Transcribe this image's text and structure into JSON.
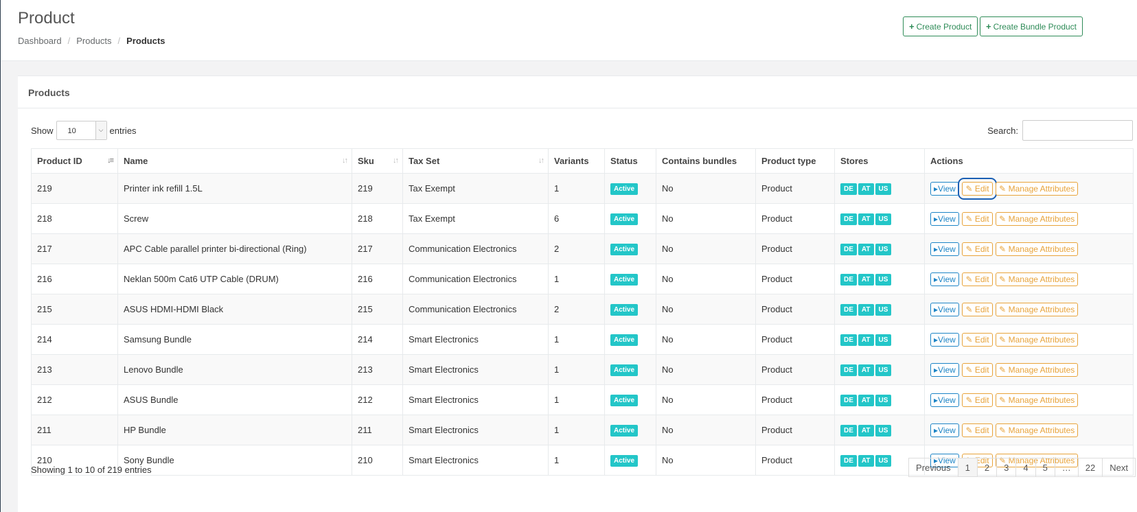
{
  "header": {
    "title": "Product",
    "breadcrumb": [
      "Dashboard",
      "Products",
      "Products"
    ],
    "create_product": "Create Product",
    "create_bundle": "Create Bundle Product"
  },
  "panel": {
    "title": "Products"
  },
  "length": {
    "show": "Show",
    "value": "10",
    "entries": "entries"
  },
  "search": {
    "label": "Search:"
  },
  "table": {
    "columns": [
      "Product ID",
      "Name",
      "Sku",
      "Tax Set",
      "Variants",
      "Status",
      "Contains bundles",
      "Product type",
      "Stores",
      "Actions"
    ],
    "action_labels": {
      "view": "View",
      "edit": "Edit",
      "attributes": "Manage Attributes"
    },
    "rows": [
      {
        "id": "219",
        "name": "Printer ink refill 1.5L",
        "sku": "219",
        "tax": "Tax Exempt",
        "variants": "1",
        "status": "Active",
        "bundles": "No",
        "type": "Product",
        "stores": [
          "DE",
          "AT",
          "US"
        ]
      },
      {
        "id": "218",
        "name": "Screw",
        "sku": "218",
        "tax": "Tax Exempt",
        "variants": "6",
        "status": "Active",
        "bundles": "No",
        "type": "Product",
        "stores": [
          "DE",
          "AT",
          "US"
        ]
      },
      {
        "id": "217",
        "name": "APC Cable parallel printer bi-directional (Ring)",
        "sku": "217",
        "tax": "Communication Electronics",
        "variants": "2",
        "status": "Active",
        "bundles": "No",
        "type": "Product",
        "stores": [
          "DE",
          "AT",
          "US"
        ]
      },
      {
        "id": "216",
        "name": "Neklan 500m Cat6 UTP Cable (DRUM)",
        "sku": "216",
        "tax": "Communication Electronics",
        "variants": "1",
        "status": "Active",
        "bundles": "No",
        "type": "Product",
        "stores": [
          "DE",
          "AT",
          "US"
        ]
      },
      {
        "id": "215",
        "name": "ASUS HDMI-HDMI Black",
        "sku": "215",
        "tax": "Communication Electronics",
        "variants": "2",
        "status": "Active",
        "bundles": "No",
        "type": "Product",
        "stores": [
          "DE",
          "AT",
          "US"
        ]
      },
      {
        "id": "214",
        "name": "Samsung Bundle",
        "sku": "214",
        "tax": "Smart Electronics",
        "variants": "1",
        "status": "Active",
        "bundles": "No",
        "type": "Product",
        "stores": [
          "DE",
          "AT",
          "US"
        ]
      },
      {
        "id": "213",
        "name": "Lenovo Bundle",
        "sku": "213",
        "tax": "Smart Electronics",
        "variants": "1",
        "status": "Active",
        "bundles": "No",
        "type": "Product",
        "stores": [
          "DE",
          "AT",
          "US"
        ]
      },
      {
        "id": "212",
        "name": "ASUS Bundle",
        "sku": "212",
        "tax": "Smart Electronics",
        "variants": "1",
        "status": "Active",
        "bundles": "No",
        "type": "Product",
        "stores": [
          "DE",
          "AT",
          "US"
        ]
      },
      {
        "id": "211",
        "name": "HP Bundle",
        "sku": "211",
        "tax": "Smart Electronics",
        "variants": "1",
        "status": "Active",
        "bundles": "No",
        "type": "Product",
        "stores": [
          "DE",
          "AT",
          "US"
        ]
      },
      {
        "id": "210",
        "name": "Sony Bundle",
        "sku": "210",
        "tax": "Smart Electronics",
        "variants": "1",
        "status": "Active",
        "bundles": "No",
        "type": "Product",
        "stores": [
          "DE",
          "AT",
          "US"
        ]
      }
    ]
  },
  "info": "Showing 1 to 10 of 219 entries",
  "pagination": [
    "Previous",
    "1",
    "2",
    "3",
    "4",
    "5",
    "…",
    "22",
    "Next"
  ],
  "colors": {
    "primary": "#2e8b57",
    "info": "#1c84c6",
    "warning": "#e8a33a",
    "badge": "#23c6c8"
  }
}
